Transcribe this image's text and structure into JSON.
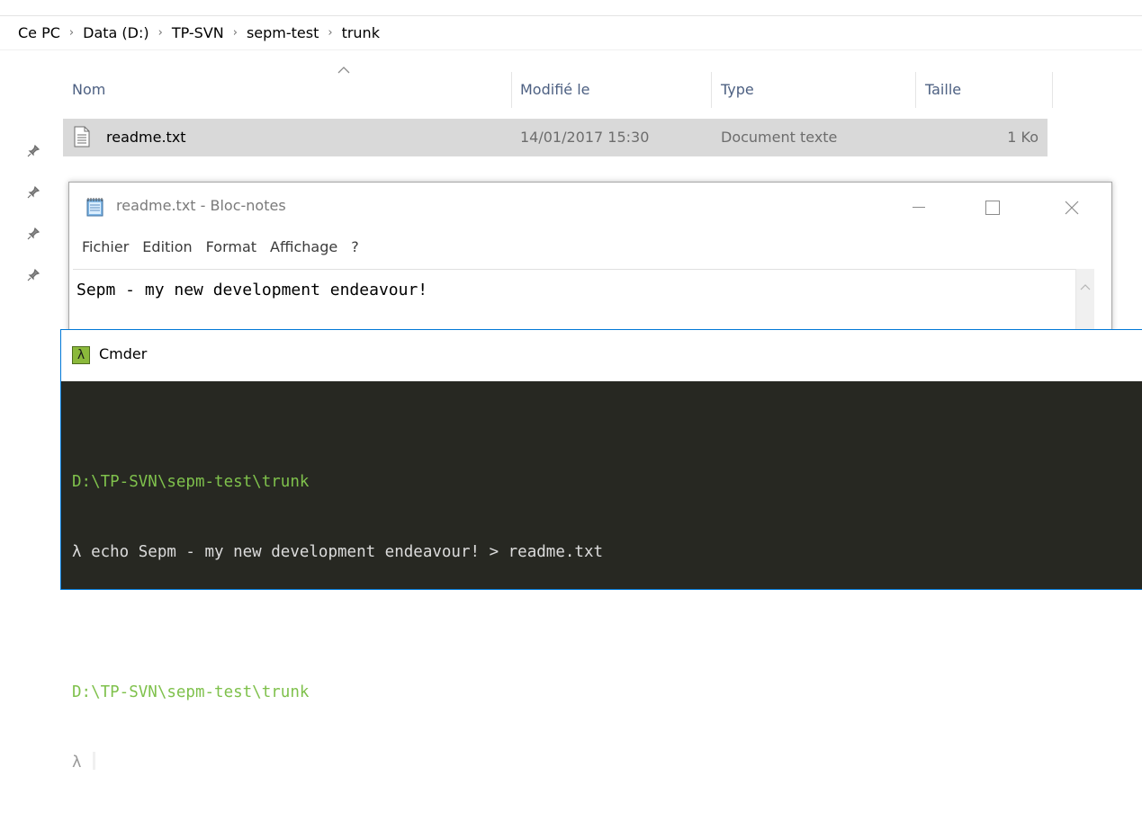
{
  "explorer": {
    "breadcrumb": [
      "Ce PC",
      "Data (D:)",
      "TP-SVN",
      "sepm-test",
      "trunk"
    ],
    "columns": {
      "name": "Nom",
      "modified": "Modifié le",
      "type": "Type",
      "size": "Taille"
    },
    "files": [
      {
        "name": "readme.txt",
        "modified": "14/01/2017 15:30",
        "type": "Document texte",
        "size": "1 Ko"
      }
    ],
    "sort": {
      "column": "name",
      "direction": "ascending"
    }
  },
  "notepad": {
    "title": "readme.txt - Bloc-notes",
    "menu": [
      "Fichier",
      "Edition",
      "Format",
      "Affichage",
      "?"
    ],
    "content": "Sepm - my new development endeavour!"
  },
  "cmder": {
    "title": "Cmder",
    "logo": "λ",
    "lines": [
      {
        "kind": "path",
        "text": "D:\\TP-SVN\\sepm-test\\trunk"
      },
      {
        "kind": "cmd",
        "text": "λ echo Sepm - my new development endeavour! > readme.txt"
      },
      {
        "kind": "blank",
        "text": ""
      },
      {
        "kind": "path",
        "text": "D:\\TP-SVN\\sepm-test\\trunk"
      }
    ],
    "prompt": "λ"
  },
  "colors": {
    "console_bg": "#272822",
    "console_path": "#7fc14c",
    "selection": "#d9d9d9",
    "active_border": "#0078d7"
  }
}
